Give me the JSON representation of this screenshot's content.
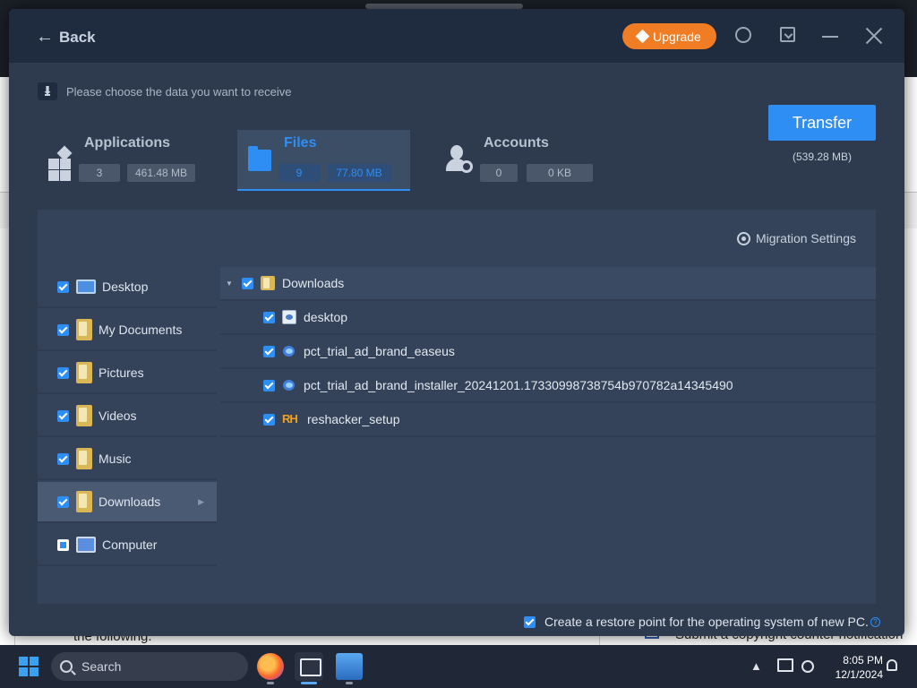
{
  "titlebar": {
    "back_label": "Back",
    "upgrade_label": "Upgrade"
  },
  "prompt": "Please choose the data you want to receive",
  "categories": [
    {
      "title": "Applications",
      "count": "3",
      "size": "461.48 MB",
      "icon": "apps-icon"
    },
    {
      "title": "Files",
      "count": "9",
      "size": "77.80 MB",
      "icon": "folder-icon",
      "selected": true
    },
    {
      "title": "Accounts",
      "count": "0",
      "size": "0 KB",
      "icon": "user-settings-icon"
    }
  ],
  "transfer": {
    "label": "Transfer",
    "size": "(539.28 MB)"
  },
  "migration_settings": "Migration Settings",
  "sidebar": {
    "items": [
      {
        "label": "Desktop",
        "checked": true
      },
      {
        "label": "My Documents",
        "checked": true
      },
      {
        "label": "Pictures",
        "checked": true
      },
      {
        "label": "Videos",
        "checked": true
      },
      {
        "label": "Music",
        "checked": true
      },
      {
        "label": "Downloads",
        "checked": true,
        "active": true
      },
      {
        "label": "Computer",
        "checked": "partial"
      }
    ]
  },
  "tree": {
    "root": {
      "label": "Downloads",
      "expanded": true
    },
    "children": [
      {
        "label": "desktop",
        "icon": "file-icon"
      },
      {
        "label": "pct_trial_ad_brand_easeus",
        "icon": "exe-icon"
      },
      {
        "label": "pct_trial_ad_brand_installer_20241201.17330998738754b970782a14345490",
        "icon": "exe-icon"
      },
      {
        "label": "reshacker_setup",
        "icon": "rh-icon"
      }
    ]
  },
  "restore_point": "Create a restore point for the operating system of new PC.",
  "background": {
    "text_left": "the following.",
    "text_right": "Submit a copyright counter notification"
  },
  "taskbar": {
    "search_label": "Search",
    "time": "8:05 PM",
    "date": "12/1/2024"
  },
  "colors": {
    "accent": "#2f8ef4",
    "upgrade": "#f07c24",
    "window_bg": "#2e3b4f"
  }
}
